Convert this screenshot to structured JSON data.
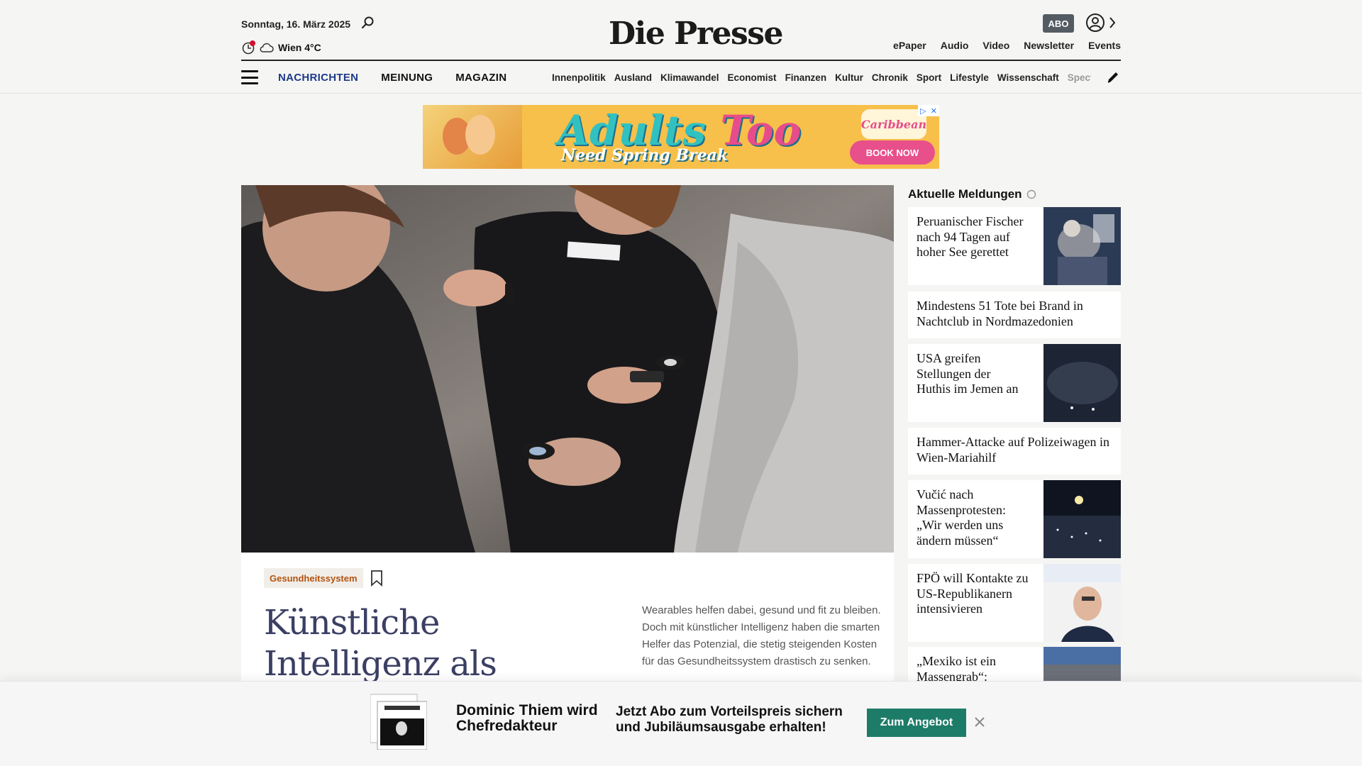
{
  "header": {
    "date": "Sonntag, 16. März 2025",
    "weather": "Wien 4°C",
    "logo": "Die Presse",
    "abo_label": "ABO",
    "top_links": [
      "ePaper",
      "Audio",
      "Video",
      "Newsletter",
      "Events"
    ],
    "main_nav": [
      "NACHRICHTEN",
      "MEINUNG",
      "MAGAZIN"
    ],
    "sub_nav": [
      "Innenpolitik",
      "Ausland",
      "Klimawandel",
      "Economist",
      "Finanzen",
      "Kultur",
      "Chronik",
      "Sport",
      "Lifestyle",
      "Wissenschaft",
      "Spectrum"
    ],
    "accent_color": "#1d3a8a"
  },
  "ad": {
    "headline_a": "Adults",
    "headline_b": "Too",
    "subline": "Need Spring Break",
    "brand": "Caribbean",
    "button": "BOOK NOW"
  },
  "hero": {
    "kicker": "Gesundheitssystem",
    "title": "Künstliche Intelligenz als digitaler",
    "teaser": "Wearables helfen dabei, gesund und fit zu bleiben. Doch mit künstlicher Intelligenz haben die smarten Helfer das Potenzial, die stetig steigenden Kosten für das Gesundheitssystem drastisch zu senken."
  },
  "sidebar": {
    "heading": "Aktuelle Meldungen",
    "items": [
      {
        "title": "Peruanischer Fischer nach 94 Tagen auf hoher See gerettet"
      },
      {
        "title": "Mindestens 51 Tote bei Brand in Nachtclub in Nordmazedonien"
      },
      {
        "title": "USA greifen Stellungen der Huthis im Jemen an"
      },
      {
        "title": "Hammer-Attacke auf Polizeiwagen in Wien-Mariahilf"
      },
      {
        "title": "Vučić nach Massenprotesten: „Wir werden uns ändern müssen“"
      },
      {
        "title": "FPÖ will Kontakte zu US-Republikanern intensivieren"
      },
      {
        "title": "„Mexiko ist ein Massengrab“:"
      }
    ]
  },
  "banner": {
    "left_text": "Dominic Thiem wird Chefredakteur",
    "right_text": "Jetzt Abo zum Vorteilspreis sichern und Jubiläumsausgabe erhalten!",
    "cta": "Zum Angebot",
    "cta_color": "#1d7c68"
  }
}
